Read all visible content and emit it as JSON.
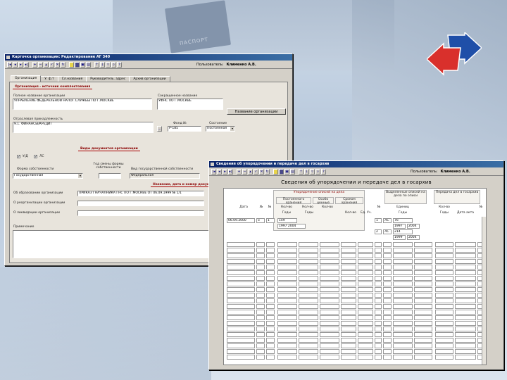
{
  "background": {
    "passport_text": "ПАСПОРТ"
  },
  "colors": {
    "titlebar_start": "#0a246a",
    "titlebar_end": "#3a6ea5",
    "window_face": "#d4d0c8",
    "accent_red": "#8b0000",
    "logo_red": "#d9302c",
    "logo_blue": "#1f4fa8"
  },
  "window1": {
    "title": "Карточка организации: Редактирование АГ 340",
    "toolbar": {
      "user_label": "Пользователь:",
      "user_name": "Клименко А.В."
    },
    "tabs": [
      "Организация",
      "У. ф.т",
      "Сл.названия",
      "Руководитель. адрес",
      "Архив организации"
    ],
    "section_main": "Организация - источник комплектования",
    "full_name_label": "Полное название организации",
    "full_name_value": "УПРАВЛЕНИЕ ФЕДЕРАЛЬНОЙ НАЛОГ.СЛУЖБЫ ПО Г.МОСКВЕ",
    "short_name_label": "Сокращенное название",
    "short_name_value": "УФНС ПО Г.МОСКВЕ",
    "org_name_button": "Название организации",
    "branch_label": "Отраслевая принадлежность",
    "branch_value": "9.1. ФИНАНСЫ/КРЕДИТ",
    "fund_label": "Фонд №",
    "fund_value": "Р-185",
    "state_label": "Состояние",
    "state_value": "Постоянная",
    "section_docs": "Виды документов организации",
    "check1_label": "У/Д",
    "check2_label": "ЛС",
    "ownership_form_label": "Форма собственности",
    "ownership_form_value": "Государственная",
    "ownership_change_label": "Год смены формы собственности",
    "state_ownership_label": "Вид государственной собственности",
    "state_ownership_value": "Федеральная",
    "section_naming": "Название, дата и номер документа",
    "founding_label": "Об образовании организации",
    "founding_value": "ПРИКАЗ ГНАЧАЛНИКА ГНС ПО Г.МОСКВЕ ОТ 06.09.1999 № 1/1",
    "reorg_label": "О реорганизации организации",
    "liquidation_label": "О ликвидации организации",
    "notes_label": "Примечание"
  },
  "window2": {
    "title": "Сведения об упорядочении и передаче дел в госархив",
    "toolbar": {
      "user_label": "Пользователь:",
      "user_name": "Клименко А.В."
    },
    "report_title": "Сведения об упорядочении и передаче дел в госархив",
    "group_ordering": "Упорядочение описей на дела",
    "group_state_storage": "Постоянного хранения",
    "group_special": "Особо ценные",
    "group_long_term": "Сроком хранения",
    "group_rejected": "Выделенные описей на дела по описи",
    "group_transfer": "Передача дел в госархив",
    "col_date": "Дата",
    "col_number": "№",
    "col_opis": "№",
    "col_qty": "Кол-во",
    "col_qty2": "Кол-во",
    "col_qty3": "Кол-во",
    "col_years": "Годы",
    "col_years2": "Годы",
    "col_kind": "Кол-во",
    "col_unit": "Ед. Уч.",
    "col_opis2": "№",
    "col_edin": "Единиц",
    "col_years3": "Годы",
    "col_transfer_qty": "Кол-во",
    "col_transfer_years": "Годы",
    "col_act_date": "Дата акта",
    "col_act_no": "№",
    "rows_left": [
      [
        "06.09.2000",
        "5",
        "1",
        "149"
      ],
      [
        "",
        "",
        "",
        "1997  2004"
      ]
    ],
    "rows_right": [
      [
        "1",
        "ЛС",
        "76",
        ""
      ],
      [
        "",
        "",
        "1997",
        "2004"
      ],
      [
        "2",
        "ЛС",
        "214",
        ""
      ],
      [
        "",
        "",
        "1999",
        "2004"
      ]
    ]
  }
}
